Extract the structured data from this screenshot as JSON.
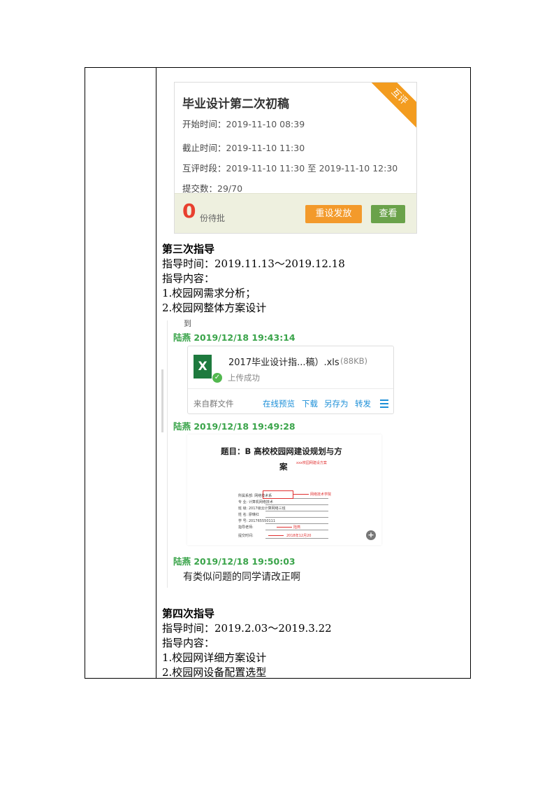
{
  "card": {
    "title": "毕业设计第二次初稿",
    "badge": "互评",
    "start_label": "开始时间：",
    "start_value": "2019-11-10 08:39",
    "deadline_label": "截止时间：",
    "deadline_value": "2019-11-10 11:30",
    "peer_label": "互评时段：",
    "peer_value": "2019-11-10 11:30 至 2019-11-10 12:30",
    "submit_label": "提交数：",
    "submit_value": "29/70",
    "pending_count": "0",
    "pending_label": "份待批",
    "reset_button": "重设发放",
    "view_button": "查看",
    "colors": {
      "badge": "#f39c1f",
      "reset": "#f39a2b",
      "view": "#6aa24a",
      "pending": "#e8402f"
    }
  },
  "third": {
    "heading": "第三次指导",
    "time": "指导时间：2019.11.13～2019.12.18",
    "content_label": "指导内容：",
    "items": [
      "1.校园网需求分析；",
      "2.校园网整体方案设计"
    ]
  },
  "chat": {
    "cut_glyph": "到",
    "messages": [
      {
        "sender": "陆燕 2019/12/18 19:43:14"
      },
      {
        "sender": "陆燕 2019/12/18 19:49:28"
      },
      {
        "sender": "陆燕 2019/12/18 19:50:03",
        "text": "有类似问题的同学请改正啊"
      }
    ],
    "file": {
      "icon": "excel-file-icon",
      "name": "2017毕业设计指...稿）.xls",
      "size": "(88KB)",
      "status": "上传成功",
      "source": "来自群文件",
      "actions": [
        "在线预览",
        "下载",
        "另存为",
        "转发"
      ]
    },
    "preview": {
      "title_line1": "题目：B 高校校园网建设规划与方",
      "title_line2": "案",
      "red_note": "xxx校园网建设方案",
      "rows": [
        "所属系部:",
        "专    业:",
        "班    级:",
        "姓    名:",
        "学    号:",
        "指导老师:",
        "提交时间:"
      ],
      "values": [
        "网络技术系",
        "计算机网络技术",
        "2017级云计算网络三班",
        "廖琳红",
        "201765550111",
        "",
        ""
      ],
      "red_marks": [
        "网络技术学院",
        "陆燕",
        "2018年12月20"
      ]
    }
  },
  "fourth": {
    "heading": "第四次指导",
    "time": "指导时间：2019.2.03～2019.3.22",
    "content_label": "指导内容：",
    "items": [
      "1.校园网详细方案设计",
      "2.校园网设备配置选型"
    ]
  }
}
